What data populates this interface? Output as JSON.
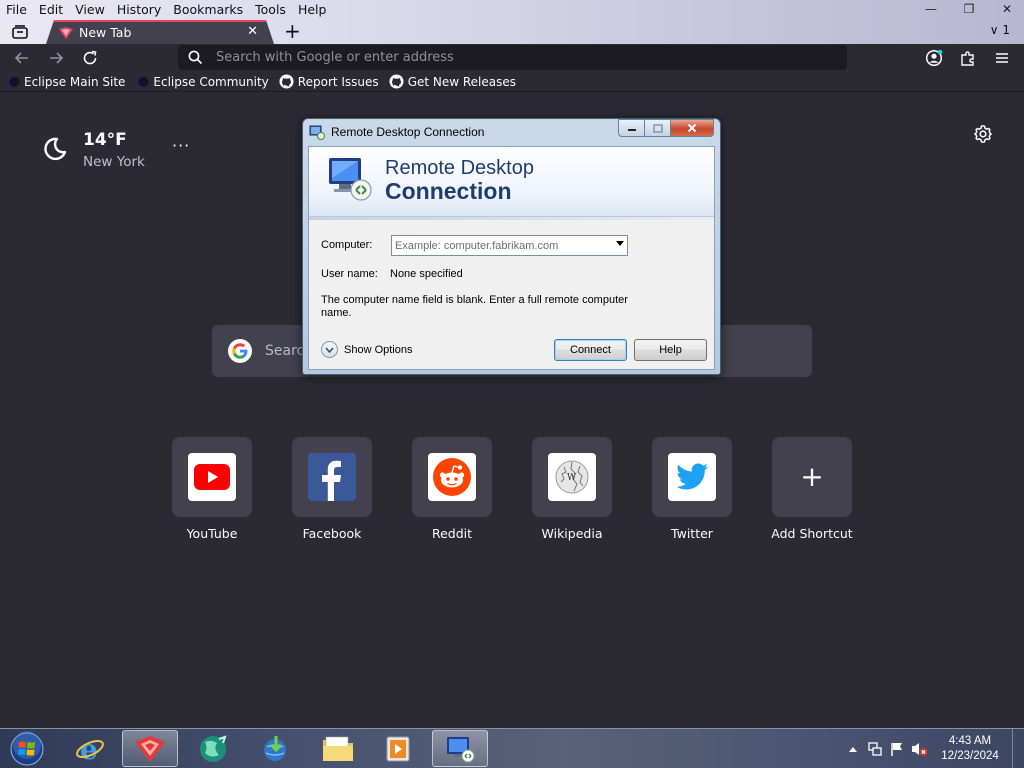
{
  "browser": {
    "menu": [
      "File",
      "Edit",
      "View",
      "History",
      "Bookmarks",
      "Tools",
      "Help"
    ],
    "window_controls": {
      "minimize": "—",
      "restore": "❐",
      "close": "✕"
    },
    "tab": {
      "title": "New Tab",
      "close": "✕"
    },
    "new_tab": "+",
    "tab_count": "∨ 1",
    "url_placeholder": "Search with Google or enter address",
    "bookmarks": [
      "Eclipse Main Site",
      "Eclipse Community",
      "Report Issues",
      "Get New Releases"
    ]
  },
  "newtab": {
    "weather": {
      "temp": "14°F",
      "city": "New York",
      "more": "···"
    },
    "search_placeholder": "Search",
    "shortcuts": [
      "YouTube",
      "Facebook",
      "Reddit",
      "Wikipedia",
      "Twitter",
      "Add Shortcut"
    ],
    "add_symbol": "+"
  },
  "dialog": {
    "title": "Remote Desktop Connection",
    "banner_line1": "Remote Desktop",
    "banner_line2": "Connection",
    "computer_label": "Computer:",
    "computer_placeholder": "Example: computer.fabrikam.com",
    "username_label": "User name:",
    "username_value": "None specified",
    "message": "The computer name field is blank. Enter a full remote computer name.",
    "show_options": "Show Options",
    "connect": "Connect",
    "help": "Help"
  },
  "taskbar": {
    "time": "4:43 AM",
    "date": "12/23/2024"
  },
  "colors": {
    "page_bg": "#2b2a33",
    "tile_bg": "#42414d",
    "tab_accent": "#e94560",
    "rdp_title_blue": "#1d3d72"
  }
}
